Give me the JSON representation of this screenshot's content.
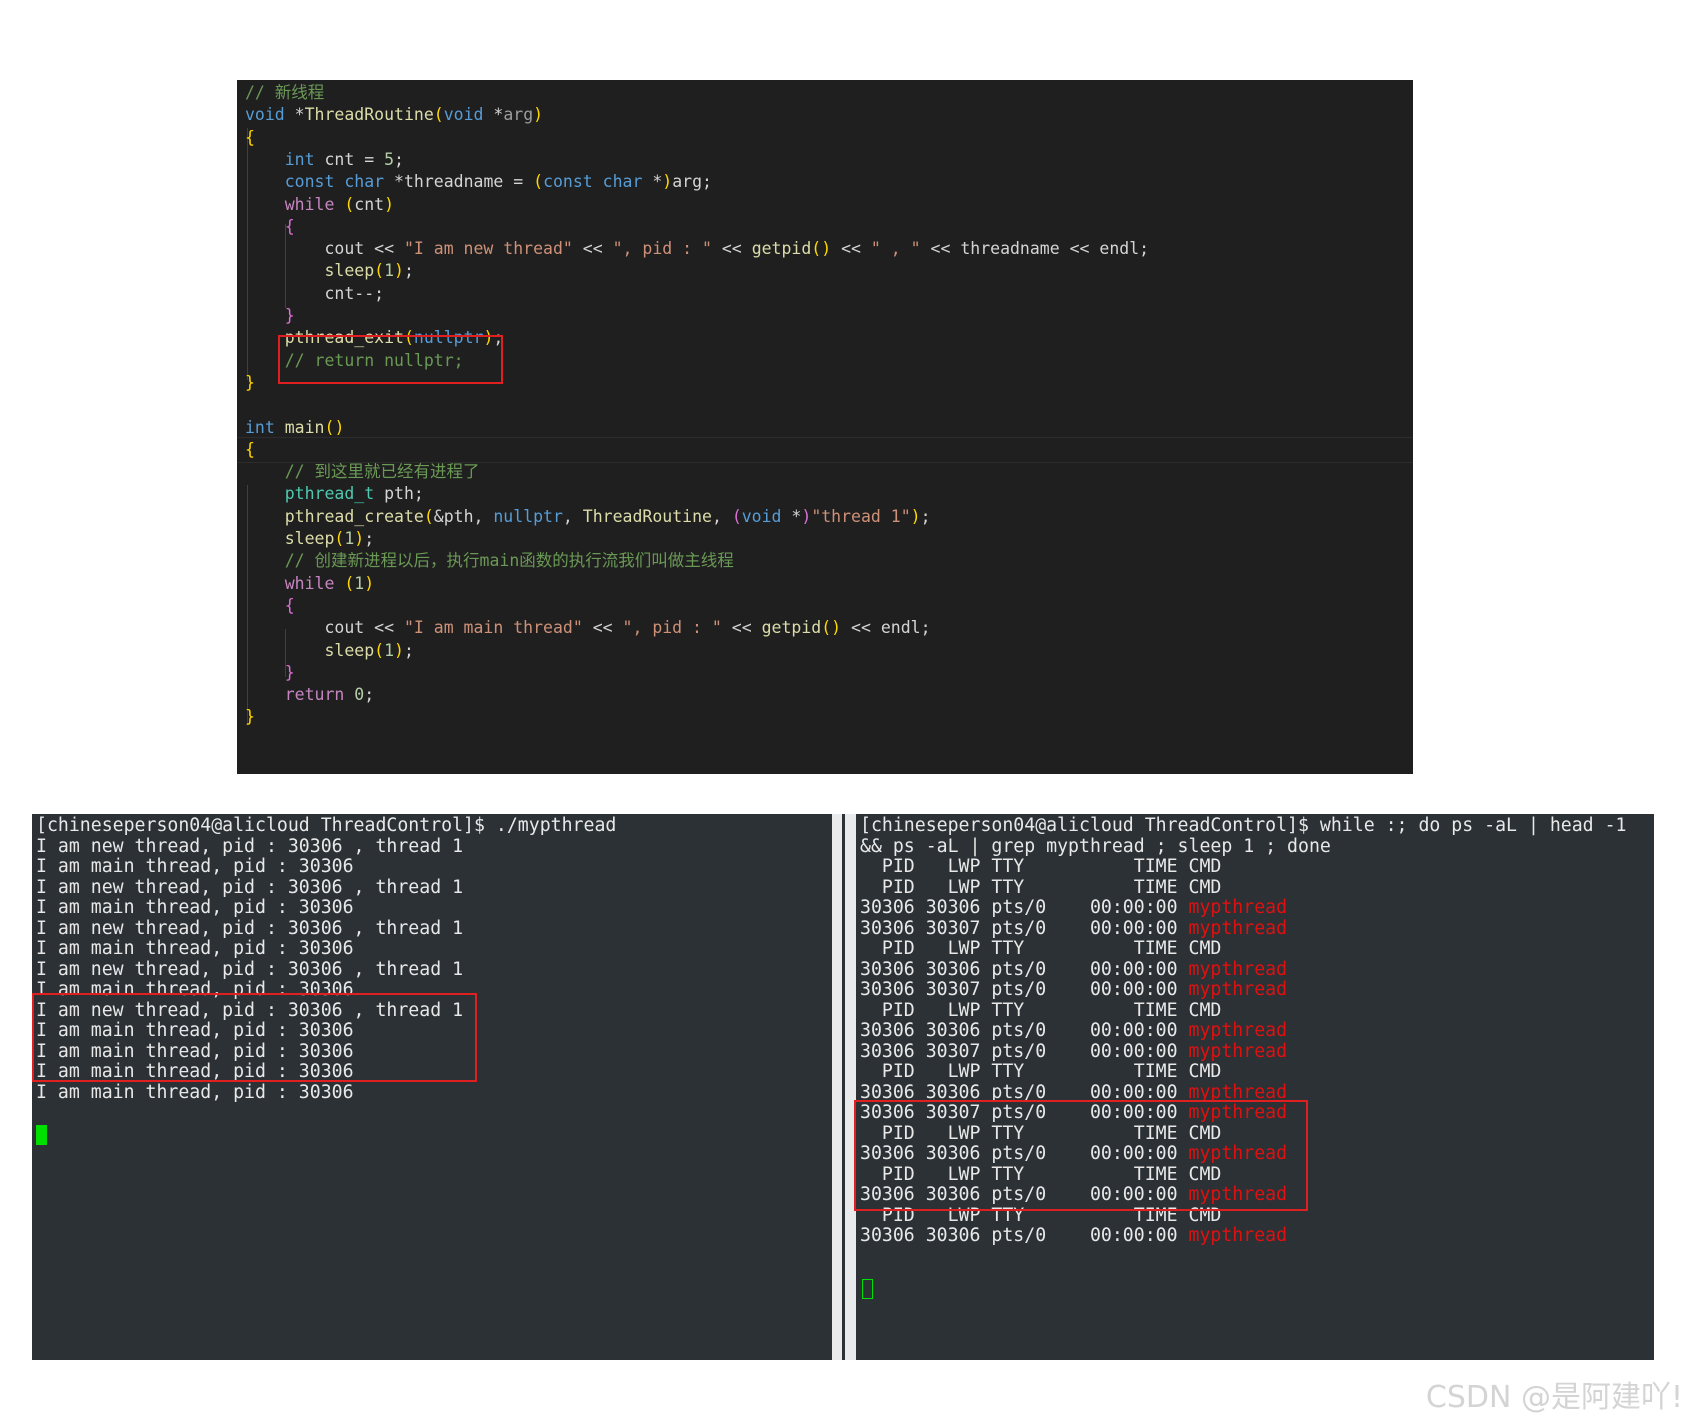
{
  "editor": {
    "lines": [
      "// 新线程",
      "void *ThreadRoutine(void *arg)",
      "{",
      "    int cnt = 5;",
      "    const char *threadname = (const char *)arg;",
      "    while (cnt)",
      "    {",
      "        cout << \"I am new thread\" << \", pid : \" << getpid() << \" , \" << threadname << endl;",
      "        sleep(1);",
      "        cnt--;",
      "    }",
      "    pthread_exit(nullptr);",
      "    // return nullptr;",
      "}",
      "",
      "int main()",
      "{",
      "    // 到这里就已经有进程了",
      "    pthread_t pth;",
      "    pthread_create(&pth, nullptr, ThreadRoutine, (void *)\"thread 1\");",
      "    sleep(1);",
      "    // 创建新进程以后，执行main函数的执行流我们叫做主线程",
      "    while (1)",
      "    {",
      "        cout << \"I am main thread\" << \", pid : \" << getpid() << endl;",
      "        sleep(1);",
      "    }",
      "    return 0;",
      "}"
    ]
  },
  "terminal_left": {
    "lines": [
      "[chineseperson04@alicloud ThreadControl]$ ./mypthread",
      "I am new thread, pid : 30306 , thread 1",
      "I am main thread, pid : 30306",
      "I am new thread, pid : 30306 , thread 1",
      "I am main thread, pid : 30306",
      "I am new thread, pid : 30306 , thread 1",
      "I am main thread, pid : 30306",
      "I am new thread, pid : 30306 , thread 1",
      "I am main thread, pid : 30306",
      "I am new thread, pid : 30306 , thread 1",
      "I am main thread, pid : 30306",
      "I am main thread, pid : 30306",
      "I am main thread, pid : 30306",
      "I am main thread, pid : 30306"
    ]
  },
  "terminal_right": {
    "command_lines": [
      "[chineseperson04@alicloud ThreadControl]$ while :; do ps -aL | head -1",
      "&& ps -aL | grep mypthread ; sleep 1 ; done"
    ],
    "header": "  PID   LWP TTY          TIME CMD",
    "row_prefix_main": "30306 30306 pts/0    00:00:00 ",
    "row_prefix_new": "30306 30307 pts/0    00:00:00 ",
    "process_name": "mypthread",
    "sequence": [
      "H",
      "H",
      "M",
      "N",
      "H",
      "M",
      "N",
      "H",
      "M",
      "N",
      "H",
      "M",
      "N",
      "H",
      "M",
      "H",
      "M",
      "H",
      "M"
    ]
  },
  "watermark": "CSDN @是阿建吖!",
  "colors": {
    "editor_bg": "#1f1f1f",
    "terminal_bg": "#2b3135",
    "highlight_box": "#e02020",
    "cursor": "#00e000"
  }
}
